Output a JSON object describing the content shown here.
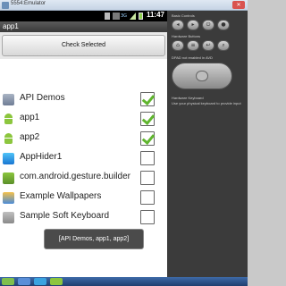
{
  "window": {
    "title": "5554:Emulator"
  },
  "status_bar": {
    "time": "11:47",
    "network_label": "3G"
  },
  "app_title": "app1",
  "check_button": {
    "label": "Check Selected"
  },
  "apps": [
    {
      "label": "API Demos",
      "icon": "folder-icon",
      "checked": true
    },
    {
      "label": "app1",
      "icon": "android-icon",
      "checked": true
    },
    {
      "label": "app2",
      "icon": "android-icon",
      "checked": true
    },
    {
      "label": "AppHider1",
      "icon": "apphider-icon",
      "checked": false
    },
    {
      "label": "com.android.gesture.builder",
      "icon": "gesture-icon",
      "checked": false
    },
    {
      "label": "Example Wallpapers",
      "icon": "wallpaper-icon",
      "checked": false
    },
    {
      "label": "Sample Soft Keyboard",
      "icon": "keyboard-icon",
      "checked": false
    }
  ],
  "toast": {
    "text": "[API Demos, app1, app2]"
  },
  "hw_panel": {
    "basic_controls": "Basic Controls",
    "hardware_buttons": "Hardware Buttons",
    "dpad_label": "DPAD not enabled in AVD",
    "hardware_keyboard": "Hardware Keyboard",
    "keyboard_hint": "Use your physical keyboard to provide input"
  },
  "colors": {
    "check": "#5fb52e",
    "title_bar": "#4a4a4a",
    "status_bar": "#000000"
  }
}
